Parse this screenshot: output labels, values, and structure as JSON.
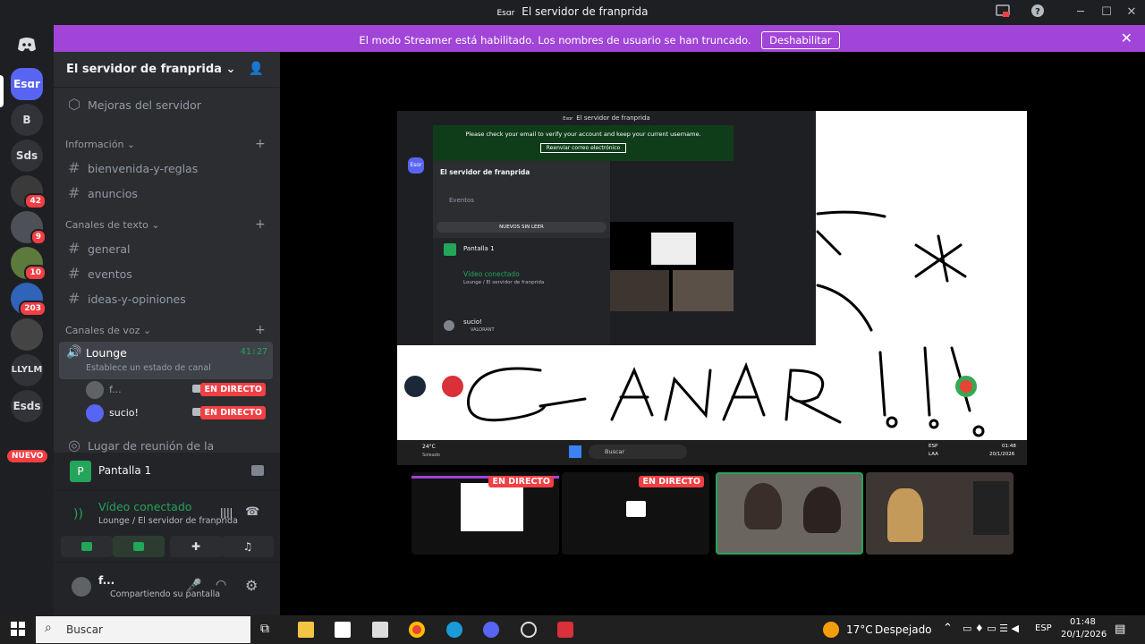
{
  "window": {
    "esc": "Esɑr",
    "title": "El servidor de franprida"
  },
  "banner": {
    "message": "El modo Streamer está habilitado. Los nombres de usuario se han truncado.",
    "button": "Deshabilitar"
  },
  "guilds": {
    "items": [
      {
        "label": "Esɑr",
        "badge": ""
      },
      {
        "label": "B",
        "badge": ""
      },
      {
        "label": "Sds",
        "badge": ""
      },
      {
        "label": "",
        "badge": "42"
      },
      {
        "label": "",
        "badge": "9"
      },
      {
        "label": "",
        "badge": "10"
      },
      {
        "label": "",
        "badge": "203"
      },
      {
        "label": "",
        "badge": ""
      },
      {
        "label": "LLYLM",
        "badge": ""
      },
      {
        "label": "Esds",
        "badge": ""
      }
    ],
    "new_label": "NUEVO"
  },
  "sidebar": {
    "server_name": "El servidor de franprida",
    "boost": "Mejoras del servidor",
    "cat_info": "Información",
    "ch_bienvenida": "bienvenida-y-reglas",
    "ch_anuncios": "anuncios",
    "cat_texto": "Canales de texto",
    "ch_general": "general",
    "ch_eventos": "eventos",
    "ch_ideas": "ideas-y-opiniones",
    "cat_voz": "Canales de voz",
    "lounge": "Lounge",
    "lounge_time": "41:27",
    "lounge_status": "Establece un estado de canal",
    "user1": "f...",
    "user2": "sucio!",
    "live": "EN DIRECTO",
    "stage": "Lugar de reunión de la comunidad"
  },
  "screen_panel": {
    "title": "Pantalla 1"
  },
  "voice_panel": {
    "status": "Vídeo conectado",
    "location": "Lounge / El servidor de franprida"
  },
  "user_panel": {
    "name": "f...",
    "status": "Compartiendo su pantalla"
  },
  "inner": {
    "title": "El servidor de franprida",
    "notice": "Please check your email to verify your account and keep your current username.",
    "resend": "Reenviar correo electrónico",
    "server": "El servidor de franprida",
    "events": "Eventos",
    "unread": "NUEVOS SIN LEER",
    "screen": "Pantalla 1",
    "voice_status": "Vídeo conectado",
    "voice_loc": "Lounge / El servidor de franprida",
    "user": "sucio!",
    "user_status": "VALORANT",
    "weather": "24°C",
    "weather_desc": "Soleado",
    "search": "Buscar",
    "lang": "ESP",
    "lang2": "LAA",
    "time": "01:48",
    "date": "20/1/2026"
  },
  "thumbs": {
    "live1": "EN DIRECTO",
    "live2": "EN DIRECTO"
  },
  "taskbar": {
    "search": "Buscar",
    "temp": "17°C",
    "weather": "Despejado",
    "lang": "ESP",
    "time": "01:48",
    "date": "20/1/2026"
  }
}
